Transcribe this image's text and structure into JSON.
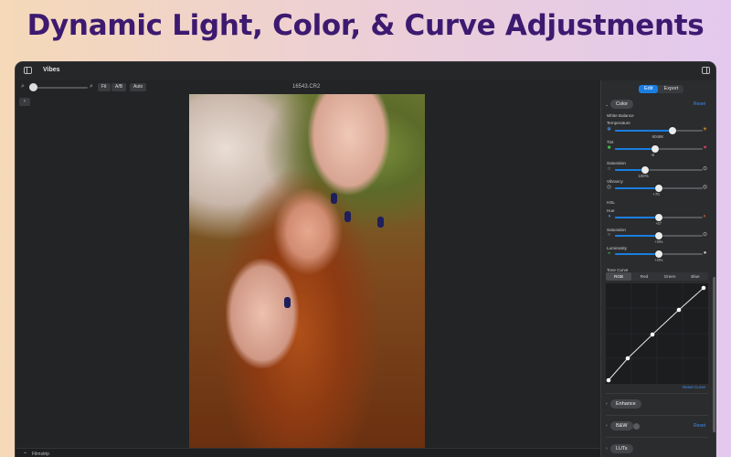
{
  "headline": "Dynamic Light, Color, & Curve Adjustments",
  "window": {
    "app_title": "Vibes",
    "filename": "16543.CR2"
  },
  "toolbar": {
    "fit_label": "Fit",
    "ab_label": "A/B",
    "auto_label": "Auto"
  },
  "filmstrip_label": "Filmstrip",
  "inspector": {
    "tabs": [
      {
        "label": "Edit",
        "active": true
      },
      {
        "label": "Export",
        "active": false
      }
    ],
    "color_section": {
      "title": "Color",
      "reset": "Reset",
      "white_balance_label": "White Balance",
      "temperature": {
        "label": "Temperature",
        "value_text": "6048K",
        "level": 0.66
      },
      "tint": {
        "label": "Tint",
        "value_text": "-8",
        "level": 0.46
      },
      "saturation": {
        "label": "Saturation",
        "value_text": "100%",
        "level": 0.34
      },
      "vibrancy": {
        "label": "Vibrancy",
        "value_text": "+70",
        "level": 0.5
      },
      "hsl_label": "HSL",
      "hue": {
        "label": "Hue",
        "value_text": "+0°",
        "level": 0.5
      },
      "hsl_saturation": {
        "label": "Saturation",
        "value_text": "+0%",
        "level": 0.5
      },
      "luminosity": {
        "label": "Luminosity",
        "value_text": "+0%",
        "level": 0.5
      }
    },
    "tone_curve": {
      "label": "Tone Curve",
      "tabs": [
        "RGB",
        "Red",
        "Green",
        "Blue"
      ],
      "active_tab": "RGB",
      "reset": "Reset Curve"
    },
    "enhance": {
      "title": "Enhance"
    },
    "bw": {
      "title": "B&W",
      "reset": "Reset"
    },
    "luts": {
      "title": "LUTs"
    }
  },
  "icons": {
    "sidebar": "sidebar-icon",
    "inspector": "inspector-icon",
    "zoom_out": "magnifier-minus-icon",
    "zoom_in": "magnifier-plus-icon"
  },
  "colors": {
    "accent": "#1a7ee0",
    "headline": "#3d1a70"
  }
}
